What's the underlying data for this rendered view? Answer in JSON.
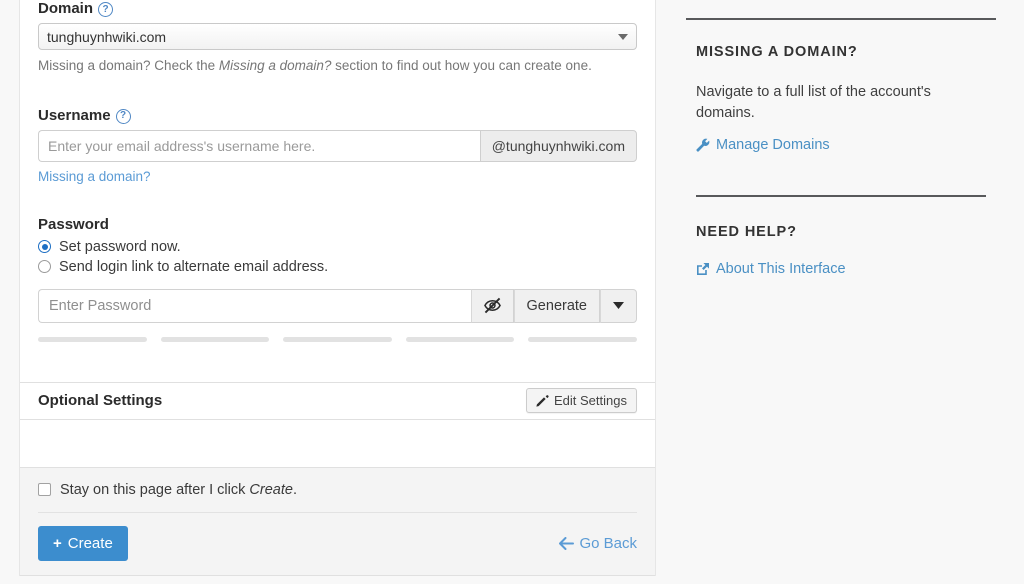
{
  "form": {
    "domain": {
      "label": "Domain",
      "help_icon": "question-circle-icon",
      "selected_value": "tunghuynhwiki.com",
      "options": [
        "tunghuynhwiki.com"
      ],
      "help_text_before": "Missing a domain? Check the ",
      "help_text_italic": "Missing a domain?",
      "help_text_after": " section to find out how you can create one."
    },
    "username": {
      "label": "Username",
      "help_icon": "question-circle-icon",
      "placeholder": "Enter your email address's username here.",
      "value": "",
      "addon": "@tunghuynhwiki.com",
      "missing_domain_link": "Missing a domain?"
    },
    "password": {
      "label": "Password",
      "options": [
        {
          "label": "Set password now.",
          "selected": true
        },
        {
          "label": "Send login link to alternate email address.",
          "selected": false
        }
      ],
      "placeholder": "Enter Password",
      "value": "",
      "toggle_icon": "eye-slash-icon",
      "generate_label": "Generate",
      "caret_icon": "caret-down-icon",
      "strength_segments": 5
    },
    "optional_settings": {
      "title": "Optional Settings",
      "edit_button_label": "Edit Settings",
      "edit_button_icon": "pencil-icon"
    },
    "footer": {
      "stay_text_before": "Stay on this page after I click ",
      "stay_text_italic": "Create",
      "stay_text_after": ".",
      "stay_checked": false,
      "create_label": "Create",
      "create_icon": "plus-icon",
      "go_back_label": "Go Back",
      "go_back_icon": "arrow-left-icon"
    }
  },
  "sidebar": {
    "missing_domain": {
      "heading": "MISSING A DOMAIN?",
      "text": "Navigate to a full list of the account's domains.",
      "link_label": "Manage Domains",
      "link_icon": "wrench-icon"
    },
    "need_help": {
      "heading": "NEED HELP?",
      "link_label": "About This Interface",
      "link_icon": "external-link-icon"
    }
  },
  "colors": {
    "accent_blue": "#3c8dce",
    "link_blue": "#5b9bd5",
    "page_background": "#f8f8f8",
    "card_background": "#ffffff",
    "footer_background": "#f4f4f4"
  }
}
